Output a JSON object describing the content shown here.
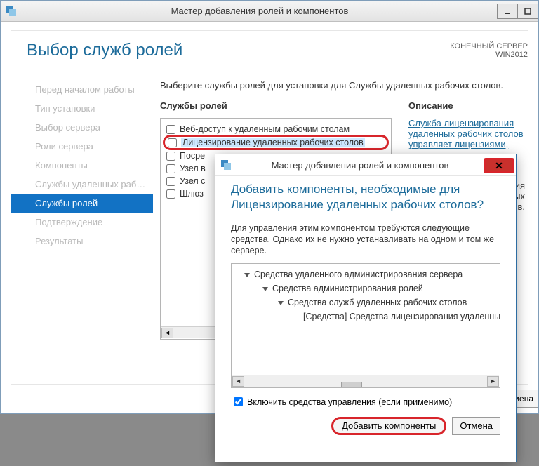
{
  "window": {
    "title": "Мастер добавления ролей и компонентов",
    "server_label": "КОНЕЧНЫЙ СЕРВЕР\nWIN2012"
  },
  "heading": "Выбор служб ролей",
  "nav": {
    "items": [
      {
        "label": "Перед началом работы",
        "state": "past"
      },
      {
        "label": "Тип установки",
        "state": "past"
      },
      {
        "label": "Выбор сервера",
        "state": "past"
      },
      {
        "label": "Роли сервера",
        "state": "past"
      },
      {
        "label": "Компоненты",
        "state": "past"
      },
      {
        "label": "Службы удаленных рабо...",
        "state": "past"
      },
      {
        "label": "Службы ролей",
        "state": "current"
      },
      {
        "label": "Подтверждение",
        "state": "future"
      },
      {
        "label": "Результаты",
        "state": "future"
      }
    ]
  },
  "main": {
    "instruction": "Выберите службы ролей для установки для Службы удаленных рабочих столов.",
    "roles_header": "Службы ролей",
    "desc_header": "Описание",
    "roles": [
      {
        "label": "Веб-доступ к удаленным рабочим столам",
        "checked": false,
        "hl": false
      },
      {
        "label": "Лицензирование удаленных рабочих столов",
        "checked": false,
        "hl": true
      },
      {
        "label": "Посре",
        "checked": false,
        "hl": false
      },
      {
        "label": "Узел в",
        "checked": false,
        "hl": false
      },
      {
        "label": "Узел с",
        "checked": false,
        "hl": false
      },
      {
        "label": "Шлюз",
        "checked": false,
        "hl": false
      }
    ],
    "desc_lines": [
      "Служба лицензирования",
      "удаленных рабочих столов",
      "управляет лицензиями,"
    ],
    "desc_tail1": "ения",
    "desc_tail2": "енных",
    "desc_tail3": "в."
  },
  "bottom_button": "мена",
  "dialog": {
    "title": "Мастер добавления ролей и компонентов",
    "heading": "Добавить компоненты, необходимые для Лицензирование удаленных рабочих столов?",
    "message": "Для управления этим компонентом требуются следующие средства. Однако их не нужно устанавливать на одном и том же сервере.",
    "tree": [
      {
        "text": "Средства удаленного администрирования сервера",
        "level": 1,
        "tri": true
      },
      {
        "text": "Средства администрирования ролей",
        "level": 2,
        "tri": true
      },
      {
        "text": "Средства служб удаленных рабочих столов",
        "level": 3,
        "tri": true
      },
      {
        "text": "[Средства] Средства лицензирования удаленных раб",
        "level": 4,
        "tri": false
      }
    ],
    "include_tools": "Включить средства управления (если применимо)",
    "include_tools_checked": true,
    "btn_add": "Добавить компоненты",
    "btn_cancel": "Отмена"
  }
}
